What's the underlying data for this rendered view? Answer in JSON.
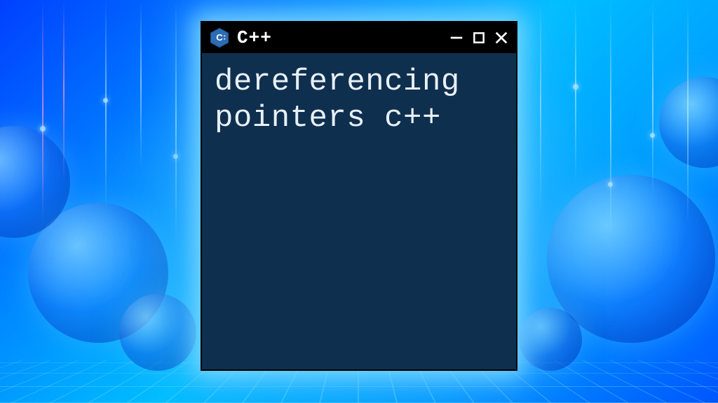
{
  "window": {
    "title": "C++",
    "icon_name": "cpp-hexagon-icon",
    "content_line1": "dereferencing",
    "content_line2": "pointers c++"
  },
  "colors": {
    "window_bg": "#0f2f4f",
    "titlebar_bg": "#000000",
    "text": "#e8f0f5",
    "glow": "#7fd8ff"
  }
}
